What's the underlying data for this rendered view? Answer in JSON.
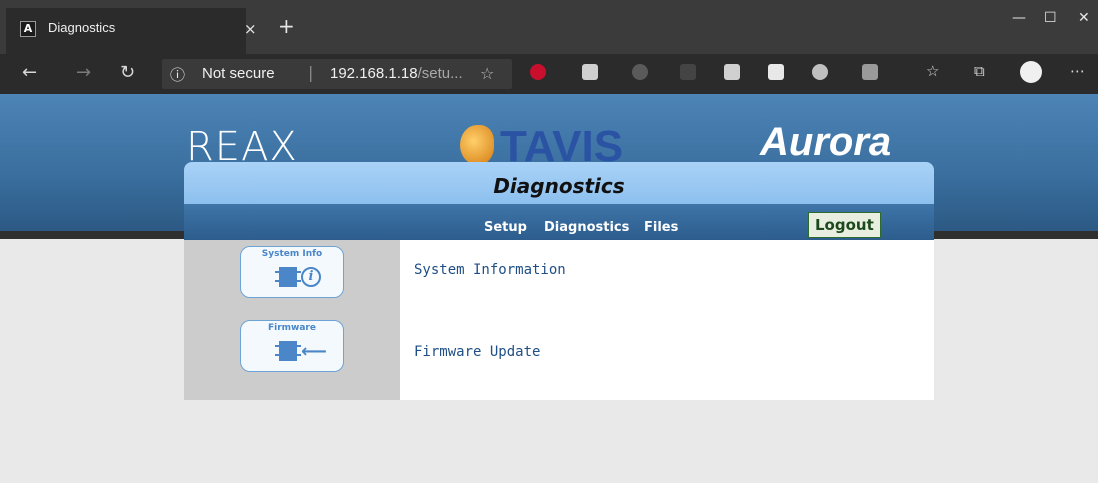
{
  "browser": {
    "tab_title": "Diagnostics",
    "tab_close": "×",
    "new_tab": "+",
    "address_secure": "Not secure",
    "address_host": "192.168.1.18",
    "address_path": "/setu...",
    "window_minimize": "—",
    "window_maximize": "☐",
    "window_close": "✕",
    "icons": [
      "back-icon",
      "forward-icon",
      "refresh-icon",
      "info-icon",
      "favorite-star-icon",
      "adblock-icon",
      "more-icon"
    ]
  },
  "header": {
    "logo_reax": "REAX",
    "logo_tavis": "TAVIS",
    "logo_aurora": "Aurora"
  },
  "panel": {
    "title": "Diagnostics",
    "nav": {
      "setup": "Setup",
      "diagnostics": "Diagnostics",
      "files": "Files"
    },
    "logout": "Logout"
  },
  "sidebar": {
    "items": [
      {
        "icon_label": "System Info",
        "link": "System Information"
      },
      {
        "icon_label": "Firmware",
        "link": "Firmware Update"
      }
    ]
  },
  "colors": {
    "header_blue": "#3a6f9f",
    "title_bar": "#a9d2f7",
    "nav_bar": "#2c5d8d",
    "link": "#1f4f86",
    "logout_border": "#2d6a2d"
  }
}
